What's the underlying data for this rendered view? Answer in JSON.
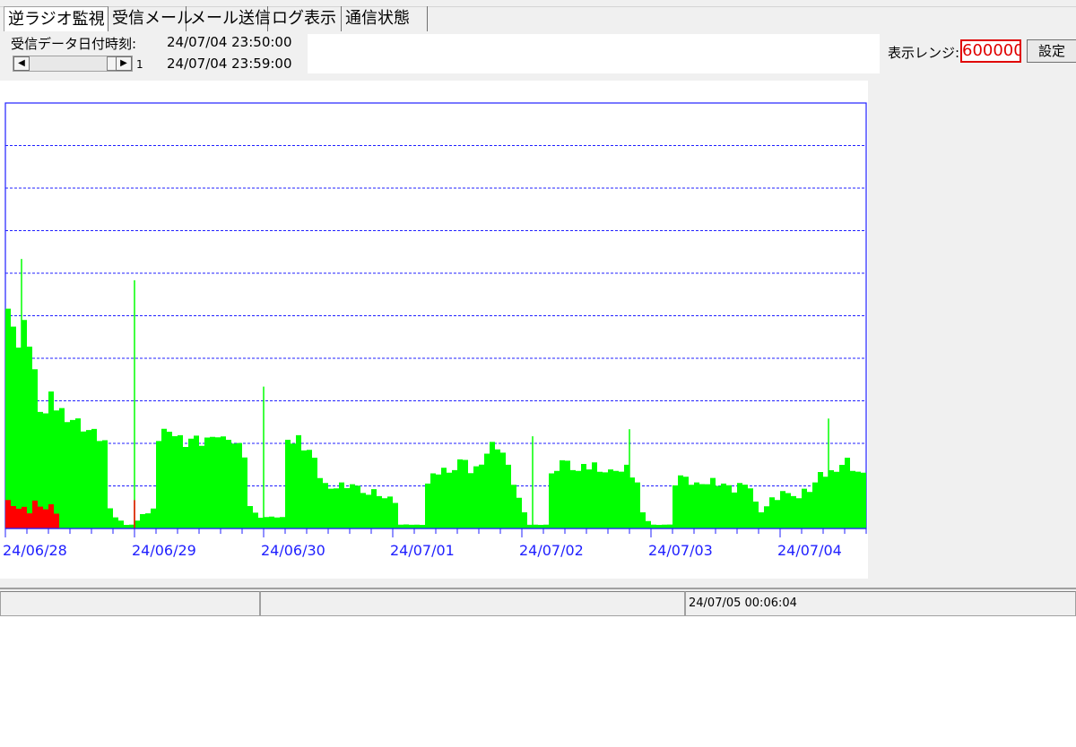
{
  "tabs": [
    {
      "label": "逆ラジオ監視",
      "active": true
    },
    {
      "label": "受信メール",
      "active": false
    },
    {
      "label": "メール送信",
      "active": false
    },
    {
      "label": "ログ表示",
      "active": false
    },
    {
      "label": "通信状態",
      "active": false
    }
  ],
  "info": {
    "received_label": "受信データ日付時刻:",
    "datetime_1": "24/07/04 23:50:00",
    "datetime_2": "24/07/04 23:59:00",
    "scroll_value": "1"
  },
  "range": {
    "label": "表示レンジ:",
    "value": "600000",
    "set_label": "設定"
  },
  "status": {
    "panel_1": "",
    "panel_2": "",
    "panel_3": "24/07/05 00:06:04"
  },
  "colors": {
    "frame": "#2020ff",
    "grid": "#2020ff",
    "series_main": "#00ff00",
    "series_alert": "#ff0000",
    "range_text": "#e00000"
  },
  "icons": {
    "scroll_left": "triangle-left",
    "scroll_right": "triangle-right"
  },
  "chart_data": {
    "type": "area",
    "x_tick_labels": [
      "24/06/28",
      "24/06/29",
      "24/06/30",
      "24/07/01",
      "24/07/02",
      "24/07/03",
      "24/07/04"
    ],
    "ylim": [
      0,
      600000
    ],
    "grid": true,
    "series": [
      {
        "values_hourly": [
          310000,
          270000,
          230000,
          290000,
          240000,
          200000,
          160000,
          150000,
          170000,
          160000,
          155000,
          150000,
          145000,
          140000,
          135000,
          130000,
          125000,
          120000,
          115000,
          25000,
          15000,
          10000,
          5000,
          5000,
          10000,
          20000,
          20000,
          25000,
          120000,
          130000,
          120000,
          125000,
          120000,
          115000,
          120000,
          118000,
          115000,
          120000,
          115000,
          125000,
          120000,
          110000,
          115000,
          110000,
          100000,
          30000,
          20000,
          15000,
          15000,
          15000,
          15000,
          15000,
          110000,
          115000,
          120000,
          110000,
          105000,
          90000,
          70000,
          60000,
          50000,
          55000,
          60000,
          50000,
          60000,
          55000,
          50000,
          45000,
          50000,
          45000,
          40000,
          40000,
          35000,
          5000,
          5000,
          5000,
          5000,
          5000,
          60000,
          70000,
          75000,
          80000,
          70000,
          80000,
          90000,
          85000,
          75000,
          80000,
          90000,
          100000,
          110000,
          110000,
          100000,
          80000,
          60000,
          40000,
          20000,
          5000,
          5000,
          5000,
          5000,
          70000,
          80000,
          90000,
          85000,
          80000,
          75000,
          80000,
          80000,
          85000,
          80000,
          75000,
          75000,
          80000,
          75000,
          80000,
          70000,
          60000,
          20000,
          10000,
          5000,
          5000,
          5000,
          5000,
          60000,
          70000,
          65000,
          60000,
          60000,
          55000,
          60000,
          65000,
          60000,
          60000,
          55000,
          50000,
          60000,
          55000,
          55000,
          35000,
          20000,
          30000,
          40000,
          40000,
          50000,
          45000,
          45000,
          40000,
          50000,
          50000,
          60000,
          70000,
          70000,
          75000,
          80000,
          85000,
          90000,
          80000,
          75000,
          70000
        ],
        "spikes": [
          {
            "hour": 3,
            "value": 380000
          },
          {
            "hour": 24,
            "value": 350000
          },
          {
            "hour": 48,
            "value": 200000
          },
          {
            "hour": 98,
            "value": 130000
          },
          {
            "hour": 116,
            "value": 140000
          },
          {
            "hour": 153,
            "value": 155000
          }
        ]
      },
      {
        "values_hourly": [
          40000,
          30000,
          25000,
          30000,
          20000,
          35000,
          30000,
          25000,
          30000,
          20000
        ],
        "spikes": [
          {
            "hour": 24,
            "value": 40000
          }
        ]
      }
    ]
  }
}
